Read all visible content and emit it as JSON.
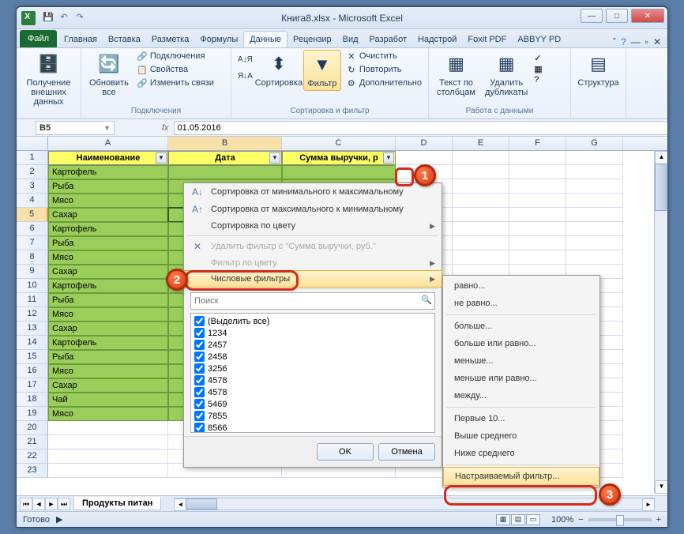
{
  "title": "Книга8.xlsx - Microsoft Excel",
  "tabs": {
    "file": "Файл",
    "list": [
      "Главная",
      "Вставка",
      "Разметка",
      "Формулы",
      "Данные",
      "Рецензир",
      "Вид",
      "Разработ",
      "Надстрой",
      "Foxit PDF",
      "ABBYY PD"
    ],
    "active_index": 4
  },
  "ribbon": {
    "g1": {
      "btn": "Получение\nвнешних данных",
      "label": ""
    },
    "g2": {
      "btn": "Обновить\nвсе",
      "i1": "Подключения",
      "i2": "Свойства",
      "i3": "Изменить связи",
      "label": "Подключения"
    },
    "g3": {
      "sort_asc": "А↓Я",
      "sort_desc": "Я↓А",
      "sort_btn": "Сортировка",
      "filter_btn": "Фильтр",
      "clear": "Очистить",
      "reapply": "Повторить",
      "advanced": "Дополнительно",
      "label": "Сортировка и фильтр"
    },
    "g4": {
      "btn1": "Текст по\nстолбцам",
      "btn2": "Удалить\nдубликаты",
      "label": "Работа с данными"
    },
    "g5": {
      "btn": "Структура"
    }
  },
  "name_box": "B5",
  "formula_value": "01.05.2016",
  "columns": [
    "A",
    "B",
    "C",
    "D",
    "E",
    "F",
    "G"
  ],
  "headers": {
    "col_a": "Наименование",
    "col_b": "Дата",
    "col_c": "Сумма выручки, р"
  },
  "data_a": [
    "Картофель",
    "Рыба",
    "Мясо",
    "Сахар",
    "Картофель",
    "Рыба",
    "Мясо",
    "Сахар",
    "Картофель",
    "Рыба",
    "Мясо",
    "Сахар",
    "Картофель",
    "Рыба",
    "Мясо",
    "Сахар",
    "Чай",
    "Мясо"
  ],
  "sheet_tab": "Продукты питан",
  "status": "Готово",
  "zoom": "100%",
  "filter_popup": {
    "sort_asc": "Сортировка от минимального к максимальному",
    "sort_desc": "Сортировка от максимального к минимальному",
    "sort_color": "Сортировка по цвету",
    "clear_filter": "Удалить фильтр с \"Сумма выручки, руб.\"",
    "filter_color": "Фильтр по цвету",
    "number_filters": "Числовые фильтры",
    "search_placeholder": "Поиск",
    "select_all": "(Выделить все)",
    "values": [
      "1234",
      "2457",
      "2458",
      "3256",
      "4578",
      "4578",
      "5469",
      "7855",
      "8566"
    ],
    "ok": "OK",
    "cancel": "Отмена"
  },
  "submenu": {
    "equals": "равно...",
    "not_equals": "не равно...",
    "greater": "больше...",
    "greater_eq": "больше или равно...",
    "less": "меньше...",
    "less_eq": "меньше или равно...",
    "between": "между...",
    "top10": "Первые 10...",
    "above_avg": "Выше среднего",
    "below_avg": "Ниже среднего",
    "custom": "Настраиваемый фильтр..."
  },
  "badges": {
    "b1": "1",
    "b2": "2",
    "b3": "3"
  }
}
